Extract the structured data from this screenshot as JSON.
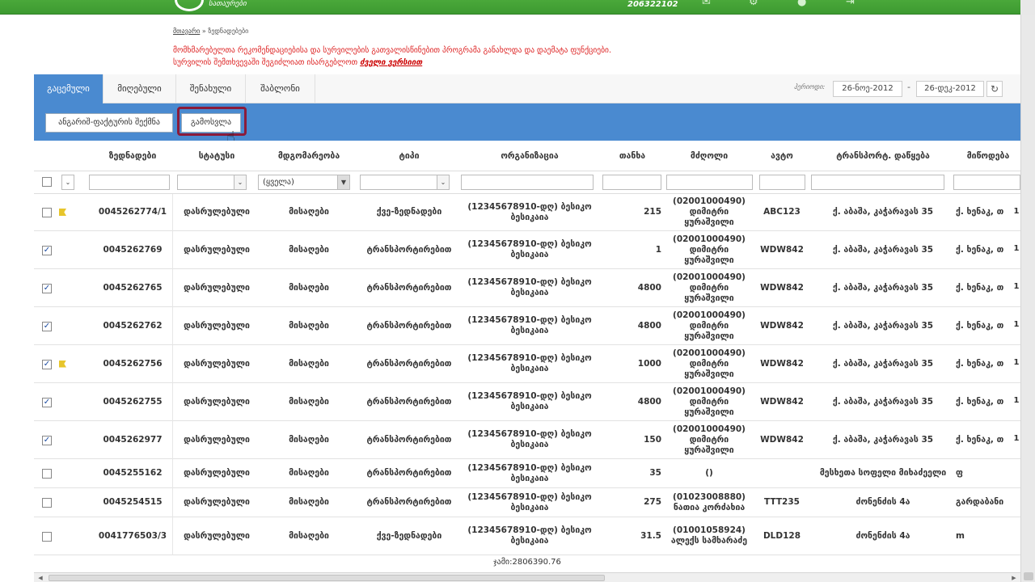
{
  "header": {
    "logo_text": "სათაურები",
    "user_id": "206322102"
  },
  "breadcrumb": {
    "home": "მთავარი",
    "separator": " » ",
    "current": "ზედნადებები"
  },
  "notice": {
    "line1": "მომხმარებელთა რეკომენდაციებისა და სურვილების გათვალისწინებით პროგრამა განახლდა და დაემატა ფუნქციები.",
    "line2_prefix": "სურვილის შემთხვევაში შეგიძლიათ ისარგებლოთ ",
    "line2_link": "ძველი ვერსიით"
  },
  "tabs": [
    "გაცემული",
    "მიღებული",
    "შენახული",
    "შაბლონი"
  ],
  "period": {
    "label": "პერიოდი:",
    "from": "26-ნოე-2012",
    "separator": "-",
    "to": "26-დეკ-2012",
    "refresh_icon": "↻"
  },
  "toolbar": {
    "invoice_btn": "ანგარიშ-ფაქტურის შექმნა",
    "export_btn": "გამოსვლა"
  },
  "columns": [
    "ზედნადები",
    "სტატუსი",
    "მდგომარეობა",
    "ტიპი",
    "ორგანიზაცია",
    "თანხა",
    "მძღოლი",
    "ავტო",
    "ტრანსპორტ. დაწყება",
    "მიწოდება"
  ],
  "filters": {
    "state_select": "(ყველა)"
  },
  "rows": [
    {
      "checked": false,
      "flag": true,
      "id": "0045262774/1",
      "status": "დასრულებული",
      "state": "მისაღები",
      "type": "ქვე-ზედნადები",
      "org": "(12345678910-დღ) ბესიკო ბესიკაია",
      "amount": "215",
      "driver": "(02001000490) დიმიტრი ყურაშვილი",
      "car": "ABC123",
      "start": "ქ. აბაშა, კაჭარავას 35",
      "delivery": "ქ. ხენაკ, თ",
      "extra": "1"
    },
    {
      "checked": true,
      "flag": false,
      "id": "0045262769",
      "status": "დასრულებული",
      "state": "მისაღები",
      "type": "ტრანსპორტირებით",
      "org": "(12345678910-დღ) ბესიკო ბესიკაია",
      "amount": "1",
      "driver": "(02001000490) დიმიტრი ყურაშვილი",
      "car": "WDW842",
      "start": "ქ. აბაშა, კაჭარავას 35",
      "delivery": "ქ. ხენაკ, თ",
      "extra": "1"
    },
    {
      "checked": true,
      "flag": false,
      "id": "0045262765",
      "status": "დასრულებული",
      "state": "მისაღები",
      "type": "ტრანსპორტირებით",
      "org": "(12345678910-დღ) ბესიკო ბესიკაია",
      "amount": "4800",
      "driver": "(02001000490) დიმიტრი ყურაშვილი",
      "car": "WDW842",
      "start": "ქ. აბაშა, კაჭარავას 35",
      "delivery": "ქ. ხენაკ, თ",
      "extra": "1"
    },
    {
      "checked": true,
      "flag": false,
      "id": "0045262762",
      "status": "დასრულებული",
      "state": "მისაღები",
      "type": "ტრანსპორტირებით",
      "org": "(12345678910-დღ) ბესიკო ბესიკაია",
      "amount": "4800",
      "driver": "(02001000490) დიმიტრი ყურაშვილი",
      "car": "WDW842",
      "start": "ქ. აბაშა, კაჭარავას 35",
      "delivery": "ქ. ხენაკ, თ",
      "extra": "1"
    },
    {
      "checked": true,
      "flag": true,
      "id": "0045262756",
      "status": "დასრულებული",
      "state": "მისაღები",
      "type": "ტრანსპორტირებით",
      "org": "(12345678910-დღ) ბესიკო ბესიკაია",
      "amount": "1000",
      "driver": "(02001000490) დიმიტრი ყურაშვილი",
      "car": "WDW842",
      "start": "ქ. აბაშა, კაჭარავას 35",
      "delivery": "ქ. ხენაკ, თ",
      "extra": "1"
    },
    {
      "checked": true,
      "flag": false,
      "id": "0045262755",
      "status": "დასრულებული",
      "state": "მისაღები",
      "type": "ტრანსპორტირებით",
      "org": "(12345678910-დღ) ბესიკო ბესიკაია",
      "amount": "4800",
      "driver": "(02001000490) დიმიტრი ყურაშვილი",
      "car": "WDW842",
      "start": "ქ. აბაშა, კაჭარავას 35",
      "delivery": "ქ. ხენაკ, თ",
      "extra": "1"
    },
    {
      "checked": true,
      "flag": false,
      "id": "0045262977",
      "status": "დასრულებული",
      "state": "მისაღები",
      "type": "ტრანსპორტირებით",
      "org": "(12345678910-დღ) ბესიკო ბესიკაია",
      "amount": "150",
      "driver": "(02001000490) დიმიტრი ყურაშვილი",
      "car": "WDW842",
      "start": "ქ. აბაშა, კაჭარავას 35",
      "delivery": "ქ. ხენაკ, თ",
      "extra": "1"
    },
    {
      "checked": false,
      "flag": false,
      "id": "0045255162",
      "status": "დასრულებული",
      "state": "მისაღები",
      "type": "ტრანსპორტირებით",
      "org": "(12345678910-დღ) ბესიკო ბესიკაია",
      "amount": "35",
      "driver": "()",
      "car": "",
      "start": "მესხეთა სოფელი მიხაძეელი",
      "delivery": "ფ",
      "extra": ""
    },
    {
      "checked": false,
      "flag": false,
      "id": "0045254515",
      "status": "დასრულებული",
      "state": "მისაღები",
      "type": "ტრანსპორტირებით",
      "org": "(12345678910-დღ) ბესიკო ბესიკაია",
      "amount": "275",
      "driver": "(01023008880) ნათია კორძახია",
      "car": "TTT235",
      "start": "ძონენძის 4ა",
      "delivery": "გარდაბანი",
      "extra": ""
    },
    {
      "checked": false,
      "flag": false,
      "id": "0041776503/3",
      "status": "დასრულებული",
      "state": "მისაღები",
      "type": "ქვე-ზედნადები",
      "org": "(12345678910-დღ) ბესიკო ბესიკაია",
      "amount": "31.5",
      "driver": "(01001058924) ალექს სამხარაძე",
      "car": "DLD128",
      "start": "ძონენძის 4ა",
      "delivery": "m",
      "extra": ""
    }
  ],
  "total": "ჯამი:2806390.76",
  "colors": {
    "topbar": "#3d9a31",
    "accent": "#4a8ad0",
    "notice": "#dd2222",
    "highlight": "#8b1b3a",
    "flag": "#e7c52b"
  }
}
